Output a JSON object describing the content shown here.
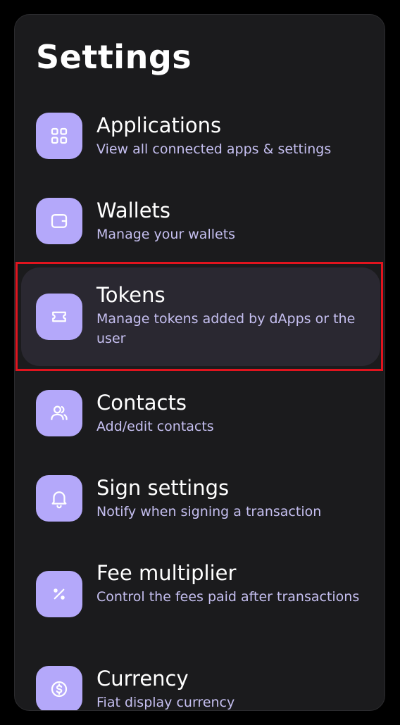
{
  "page": {
    "title": "Settings"
  },
  "items": [
    {
      "title": "Applications",
      "subtitle": "View all connected apps & settings",
      "icon": "grid-icon"
    },
    {
      "title": "Wallets",
      "subtitle": "Manage your wallets",
      "icon": "wallet-icon"
    },
    {
      "title": "Tokens",
      "subtitle": "Manage tokens added by dApps or the user",
      "icon": "ticket-icon",
      "selected": true
    },
    {
      "title": "Contacts",
      "subtitle": "Add/edit contacts",
      "icon": "users-icon"
    },
    {
      "title": "Sign settings",
      "subtitle": "Notify when signing a transaction",
      "icon": "bell-icon"
    },
    {
      "title": "Fee multiplier",
      "subtitle": "Control the fees paid after transactions",
      "icon": "percent-icon"
    },
    {
      "title": "Currency",
      "subtitle": "Fiat display currency",
      "icon": "dollar-coin-icon"
    }
  ],
  "colors": {
    "background": "#000000",
    "panel": "#1b1b1d",
    "selected_row": "#2a2831",
    "icon_tile": "#b4a8fa",
    "icon_stroke": "#ffffff",
    "subtitle": "#c5bff0",
    "highlight_outline": "#e1141e"
  }
}
